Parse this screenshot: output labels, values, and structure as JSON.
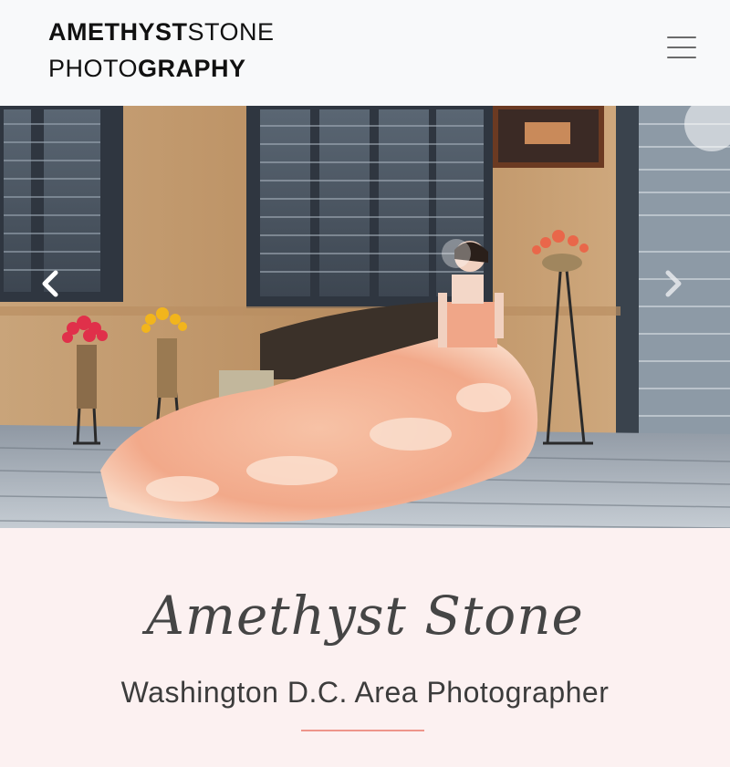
{
  "brand": {
    "part1_bold": "AMETHYST",
    "part1_light": "STONE",
    "part2_light": "PHOTO",
    "part2_bold": "GRAPHY"
  },
  "nav": {
    "menu_icon": "hamburger-menu-icon"
  },
  "carousel": {
    "prev_icon": "chevron-left-icon",
    "next_icon": "chevron-right-icon",
    "slide_image": "bride-in-peach-ruffled-gown-photo"
  },
  "intro": {
    "script_title": "Amethyst Stone",
    "subtitle": "Washington D.C. Area Photographer"
  },
  "colors": {
    "accent": "#ee958b",
    "background": "#fcf1f1",
    "header_bg": "#f8f9fa"
  }
}
